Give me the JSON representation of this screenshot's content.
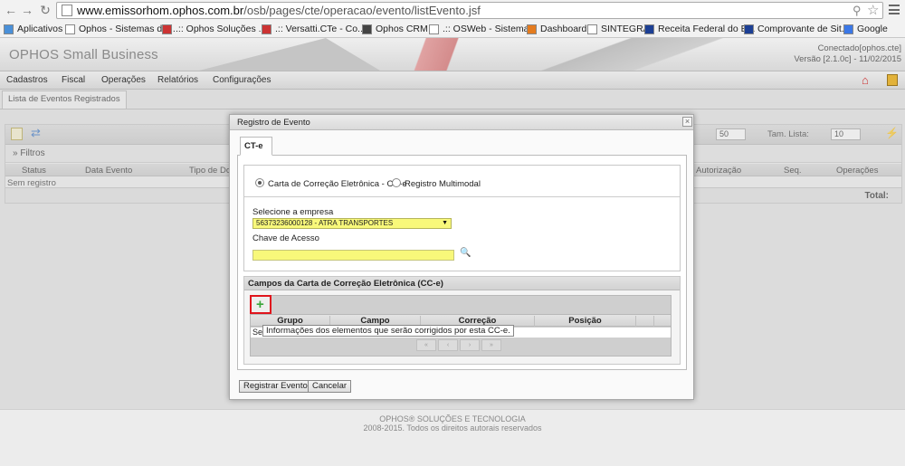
{
  "browser": {
    "url_host": "www.emissorhom.ophos.com.br",
    "url_path": "/osb/pages/cte/operacao/evento/listEvento.jsf",
    "bookmarks": [
      {
        "label": "Aplicativos",
        "icon": "apps-grid-icon"
      },
      {
        "label": "Ophos - Sistemas de...",
        "icon": "page-icon"
      },
      {
        "label": ".:: Ophos Soluções ...",
        "icon": "ophos-icon"
      },
      {
        "label": ".:: Versatti.CTe - Co...",
        "icon": "versatti-icon"
      },
      {
        "label": "Ophos CRM",
        "icon": "crm-icon"
      },
      {
        "label": ".:: OSWeb - Sistema...",
        "icon": "page-icon"
      },
      {
        "label": "Dashboard",
        "icon": "dashboard-icon"
      },
      {
        "label": "SINTEGRA",
        "icon": "page-icon"
      },
      {
        "label": "Receita Federal do B...",
        "icon": "receita-icon"
      },
      {
        "label": "Comprovante de Sit...",
        "icon": "receita-icon"
      },
      {
        "label": "Google",
        "icon": "google-icon"
      }
    ]
  },
  "app": {
    "brand": "OPHOS Small Business",
    "connected": "Conectado[ophos.cte]",
    "version": "Versão [2.1.0c] - 11/02/2015",
    "menu": [
      "Cadastros",
      "Fiscal",
      "Operações",
      "Relatórios",
      "Configurações"
    ],
    "page_tab": "Lista de Eventos Registrados"
  },
  "list": {
    "page_size_value": "50",
    "tam_lista_label": "Tam. Lista:",
    "tam_lista_value": "10",
    "filtros_label": "Filtros",
    "columns": [
      "Status",
      "Data Evento",
      "Tipo de Do",
      "Autorização",
      "Seq.",
      "Operações"
    ],
    "empty": "Sem registro",
    "total_label": "Total:"
  },
  "dialog": {
    "title": "Registro de Evento",
    "tab": "CT-e",
    "radio_cce": "Carta de Correção Eletrônica - CC-e",
    "radio_multimodal": "Registro Multimodal",
    "empresa_label": "Selecione a empresa",
    "empresa_value": "56373236000128 - ATRA TRANSPORTES",
    "chave_label": "Chave de Acesso",
    "chave_value": "",
    "campos_title": "Campos da Carta de Correção Eletrônica (CC-e)",
    "grid_columns": [
      "Grupo",
      "Campo",
      "Correção",
      "Posição"
    ],
    "grid_empty": "Sem",
    "tooltip": "Informações dos elementos que serão corrigidos por esta CC-e.",
    "pager": [
      "«",
      "‹",
      "›",
      "»"
    ],
    "btn_registrar": "Registrar Evento",
    "btn_cancelar": "Cancelar"
  },
  "footer": {
    "line1": "OPHOS® SOLUÇÕES E TECNOLOGIA",
    "line2": "2008-2015. Todos os direitos autorais reservados"
  }
}
